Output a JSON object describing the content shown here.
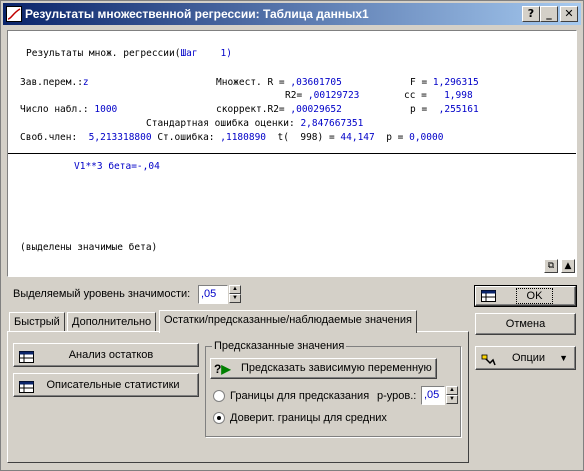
{
  "window": {
    "title": "Результаты множественной регрессии: Таблица данных1",
    "help_glyph": "?",
    "min_glyph": "_",
    "close_glyph": "✕"
  },
  "report": {
    "heading_prefix": "Результаты множ. регрессии(",
    "heading_step": "Шаг    1)",
    "dep_var_label": "Зав.перем.:",
    "dep_var": "z",
    "mult_r_label": "Множест. R =",
    "mult_r": ",03601705",
    "f_label": "F =",
    "f_value": "1,296315",
    "r2_label": "R2=",
    "r2": ",00129723",
    "cc_label": "cc =",
    "cc_value": "1,998",
    "n_label": "Число набл.:",
    "n_value": "1000",
    "adj_r2_label": "скоррект.R2=",
    "adj_r2": ",00029652",
    "p_label": "p =",
    "p_value": ",255161",
    "see_label": "Стандартная ошибка оценки:",
    "see_value": "2,847667351",
    "intercept_label": "Своб.член:",
    "intercept_value": "5,213318800",
    "stderr_label": "Ст.ошибка:",
    "stderr_value": ",1180890",
    "t_label": "t(  998) =",
    "t_value": "44,147",
    "p2_label": "p =",
    "p2_value": "0,0000",
    "beta_line": "V1**3 бета=-,04",
    "footnote": "(выделены значимые бета)"
  },
  "controls": {
    "significance_label": "Выделяемый уровень значимости:",
    "significance_value": ",05",
    "ok_label": "OK",
    "cancel_label": "Отмена",
    "options_label": "Опции"
  },
  "tabs": [
    {
      "label": "Быстрый"
    },
    {
      "label": "Дополнительно"
    },
    {
      "label": "Остатки/предсказанные/наблюдаемые значения"
    }
  ],
  "residuals_tab": {
    "analyze_residuals_label": "Анализ остатков",
    "descriptive_stats_label": "Описательные статистики",
    "predicted_group_title": "Предсказанные значения",
    "predict_button_label": "Предсказать зависимую переменную",
    "prediction_limits_label": "Границы для предсказания",
    "p_level_label": "р-уров.:",
    "p_level_value": ",05",
    "conf_limits_label": "Доверит. границы для средних",
    "selected_option": "conf_limits"
  }
}
